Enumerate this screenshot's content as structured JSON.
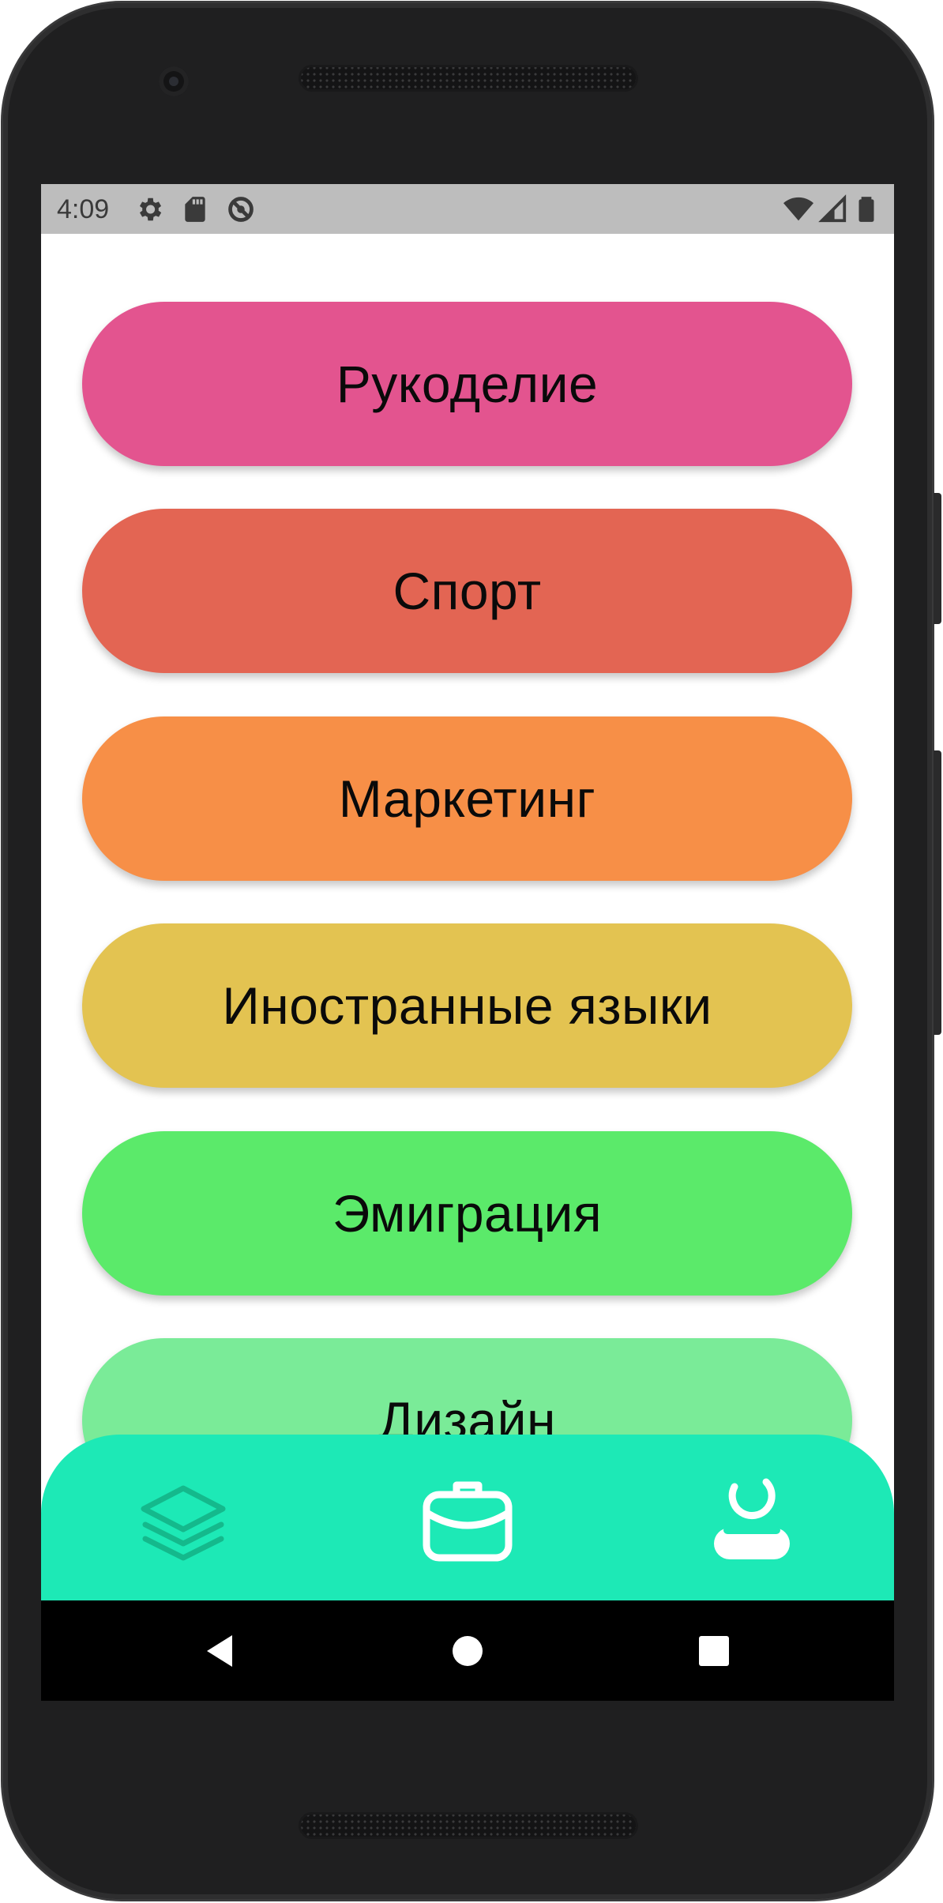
{
  "status_bar": {
    "time": "4:09",
    "left_icons": [
      "settings-icon",
      "sd-card-icon",
      "do-not-disturb-icon"
    ],
    "right_icons": [
      "wifi-icon",
      "cell-signal-icon",
      "battery-icon"
    ]
  },
  "categories": [
    {
      "label": "Рукоделие",
      "color": "#e3548f"
    },
    {
      "label": "Спорт",
      "color": "#e36553"
    },
    {
      "label": "Маркетинг",
      "color": "#f78f47"
    },
    {
      "label": "Иностранные языки",
      "color": "#e3c351"
    },
    {
      "label": "Эмиграция",
      "color": "#5bea6a"
    },
    {
      "label": "Дизайн",
      "color": "#7aeb98"
    }
  ],
  "bottom_nav": {
    "background": "#1de9b6",
    "items": [
      {
        "icon": "layers-icon",
        "state": "inactive",
        "color": "#14b98c"
      },
      {
        "icon": "briefcase-icon",
        "state": "active",
        "color": "#ffffff"
      },
      {
        "icon": "profile-icon",
        "state": "inactive",
        "color": "#ffffff"
      }
    ]
  },
  "system_nav": {
    "buttons": [
      "back-icon",
      "home-icon",
      "recents-icon"
    ]
  }
}
